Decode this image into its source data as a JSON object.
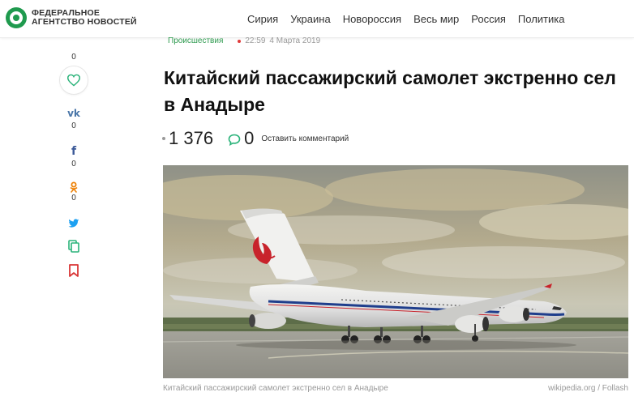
{
  "logo": {
    "line1": "ФЕДЕРАЛЬНОЕ",
    "line2": "АГЕНТСТВО НОВОСТЕЙ"
  },
  "nav": [
    "Сирия",
    "Украина",
    "Новороссия",
    "Весь мир",
    "Россия",
    "Политика"
  ],
  "social": {
    "likes": "0",
    "vk_count": "0",
    "fb_count": "0",
    "ok_count": "0",
    "vk_icon": "vk-icon",
    "fb_icon": "facebook-icon",
    "ok_icon": "odnoklassniki-icon",
    "tw_icon": "twitter-icon",
    "copy_icon": "copy-icon",
    "bookmark_icon": "bookmark-icon"
  },
  "article": {
    "rubric": "Происшествия",
    "time": "22:59",
    "date": "4 Марта 2019",
    "title": "Китайский пассажирский самолет экстренно сел в Анадыре",
    "views": "1 376",
    "comments": "0",
    "leave_comment": "Оставить комментарий",
    "photo_caption": "Китайский пассажирский самолет экстренно сел в Анадыре",
    "photo_source": "wikipedia.org / Follash"
  },
  "colors": {
    "brand": "#1f9a4e",
    "accent_red": "#d93636",
    "vk": "#4a76a8",
    "fb": "#3b5998",
    "ok": "#ee8208",
    "tw": "#1da1f2",
    "comment": "#2bb37a"
  }
}
